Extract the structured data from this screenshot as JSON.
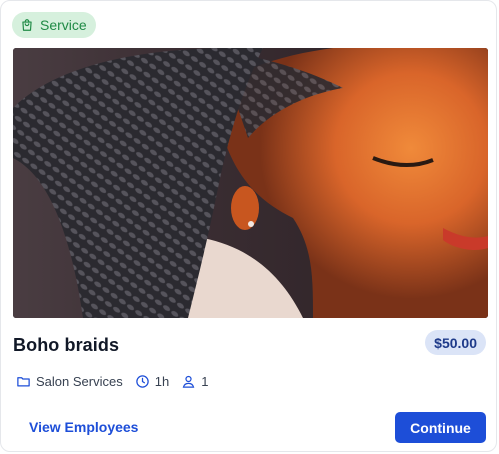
{
  "badge": {
    "label": "Service",
    "icon": "shopping-bag-icon",
    "color": "#1f8a45",
    "background": "#d6f0dd"
  },
  "service": {
    "title": "Boho braids",
    "price": "$50.00"
  },
  "meta": {
    "category": {
      "icon": "folder-icon",
      "label": "Salon Services"
    },
    "duration": {
      "icon": "clock-icon",
      "label": "1h"
    },
    "capacity": {
      "icon": "user-icon",
      "label": "1"
    }
  },
  "actions": {
    "view_employees": "View Employees",
    "continue": "Continue"
  },
  "colors": {
    "primary": "#1d4ed8",
    "price_bg": "#dbe4f7",
    "price_text": "#1e3a8a"
  }
}
